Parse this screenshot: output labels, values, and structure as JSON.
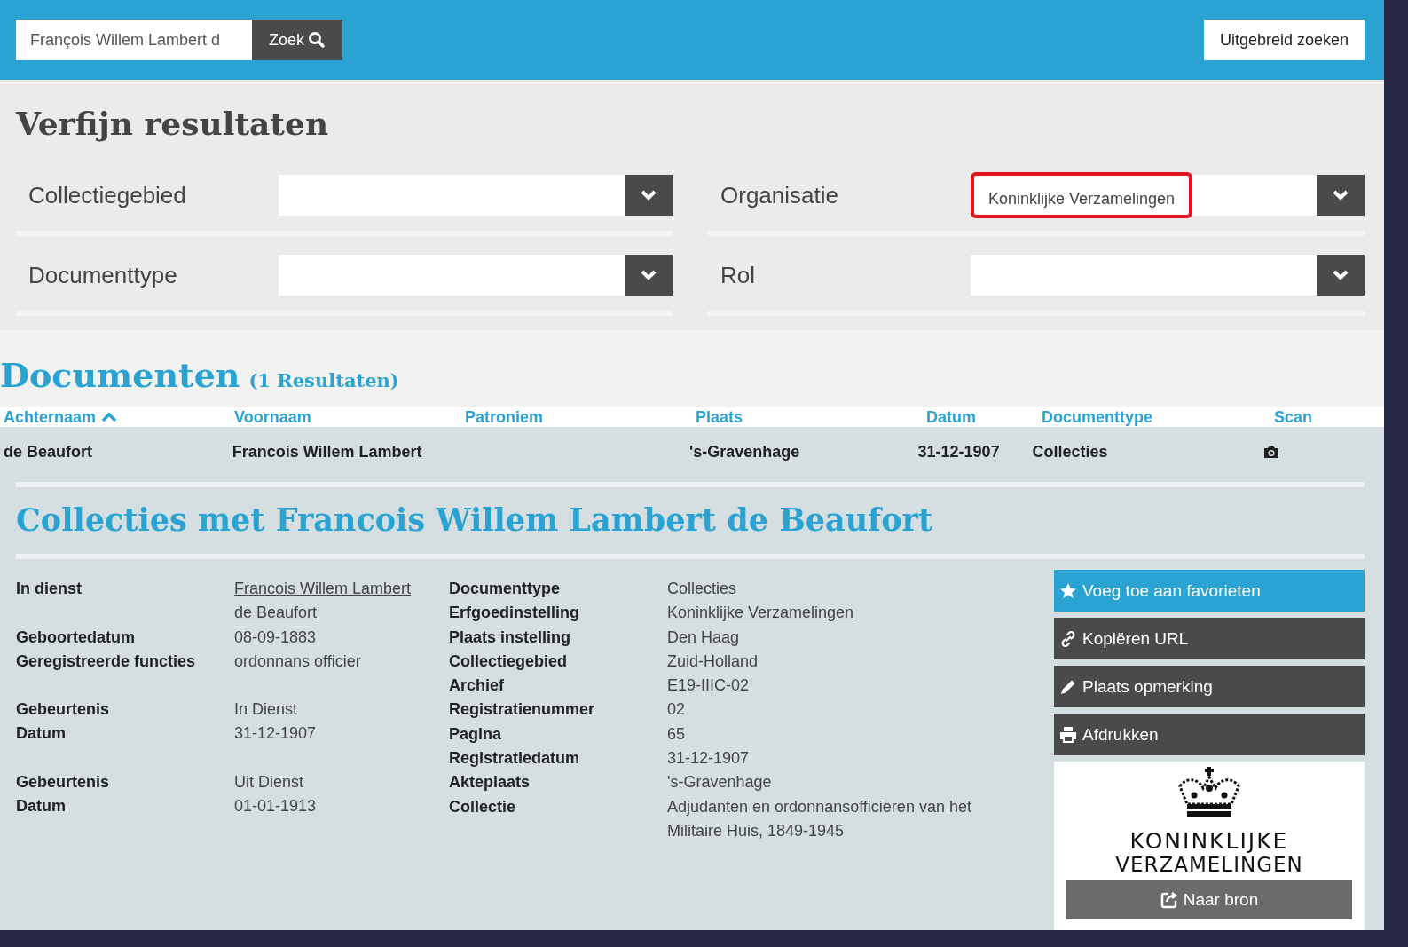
{
  "search": {
    "value": "François Willem Lambert d",
    "button": "Zoek",
    "advanced": "Uitgebreid zoeken"
  },
  "refine": {
    "title": "Verfijn resultaten",
    "filters": [
      {
        "label": "Collectiegebied",
        "highlighted": false
      },
      {
        "label": "Organisatie",
        "value": "Koninklijke Verzamelingen",
        "highlighted": true
      },
      {
        "label": "Documenttype",
        "highlighted": false
      },
      {
        "label": "Rol",
        "highlighted": false
      }
    ]
  },
  "documents": {
    "title": "Documenten",
    "count": "(1 Resultaten)",
    "columns": [
      {
        "label": "Achternaam",
        "sorted": true
      },
      {
        "label": "Voornaam",
        "sorted": false
      },
      {
        "label": "Patroniem",
        "sorted": false
      },
      {
        "label": "Plaats",
        "sorted": false
      },
      {
        "label": "Datum",
        "sorted": false
      },
      {
        "label": "Documenttype",
        "sorted": false
      },
      {
        "label": "Scan",
        "sorted": false
      }
    ],
    "rows": [
      {
        "cells": [
          "de Beaufort",
          "Francois Willem Lambert",
          "",
          "'s-Gravenhage",
          "31-12-1907",
          "Collecties"
        ],
        "scan": true
      }
    ]
  },
  "detail": {
    "title": "Collecties met Francois Willem Lambert de Beaufort",
    "left_groups": [
      [
        {
          "label": "In dienst",
          "value": "Francois Willem Lambert de Beaufort",
          "link": true
        },
        {
          "label": "Geboortedatum",
          "value": "08-09-1883",
          "link": false
        },
        {
          "label": "Geregistreerde functies",
          "value": "ordonnans officier",
          "link": false
        }
      ],
      [
        {
          "label": "Gebeurtenis",
          "value": "In Dienst",
          "link": false
        },
        {
          "label": "Datum",
          "value": "31-12-1907",
          "link": false
        }
      ],
      [
        {
          "label": "Gebeurtenis",
          "value": "Uit Dienst",
          "link": false
        },
        {
          "label": "Datum",
          "value": "01-01-1913",
          "link": false
        }
      ]
    ],
    "right": [
      {
        "label": "Documenttype",
        "value": "Collecties",
        "link": false
      },
      {
        "label": "Erfgoedinstelling",
        "value": "Koninklijke Verzamelingen",
        "link": true
      },
      {
        "label": "Plaats instelling",
        "value": "Den Haag",
        "link": false
      },
      {
        "label": "Collectiegebied",
        "value": "Zuid-Holland",
        "link": false
      },
      {
        "label": "Archief",
        "value": "E19-IIIC-02",
        "link": false
      },
      {
        "label": "Registratienummer",
        "value": "02",
        "link": false
      },
      {
        "label": "Pagina",
        "value": "65",
        "link": false
      },
      {
        "label": "Registratiedatum",
        "value": "31-12-1907",
        "link": false
      },
      {
        "label": "Akteplaats",
        "value": "'s-Gravenhage",
        "link": false
      },
      {
        "label": "Collectie",
        "value": "Adjudanten en ordonnansofficieren van het Militaire Huis, 1849-1945",
        "link": false
      }
    ],
    "actions": [
      {
        "kind": "favorite",
        "label": "Voeg toe aan favorieten"
      },
      {
        "kind": "copy",
        "label": "Kopiëren URL"
      },
      {
        "kind": "comment",
        "label": "Plaats opmerking"
      },
      {
        "kind": "print",
        "label": "Afdrukken"
      }
    ],
    "source": {
      "logo_lines": [
        "KONINKLIJKE",
        "VERZAMELINGEN"
      ],
      "button": "Naar bron"
    }
  }
}
